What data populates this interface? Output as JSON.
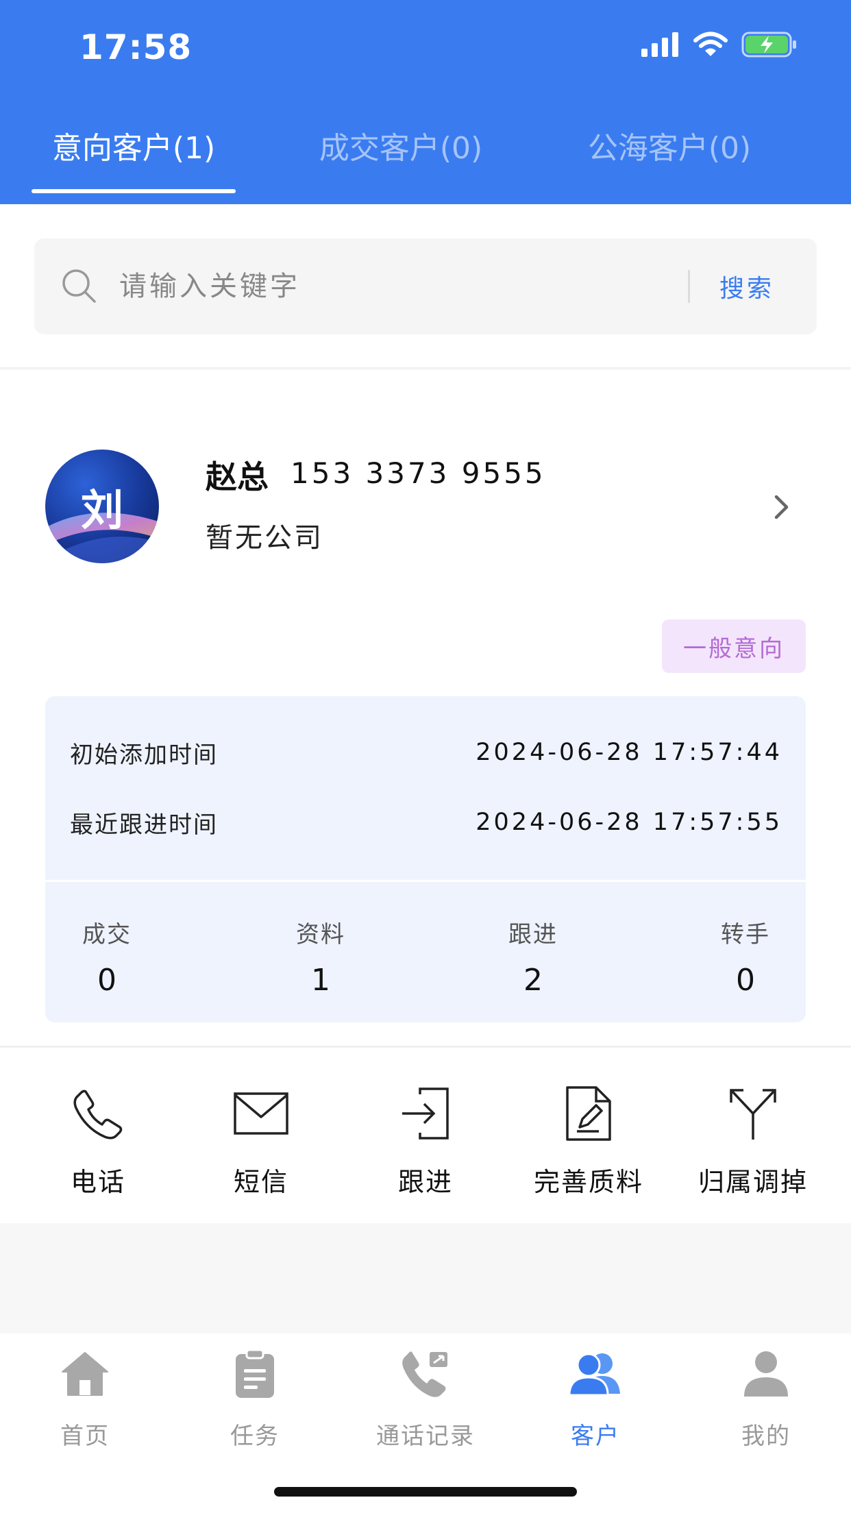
{
  "status_bar": {
    "time": "17:58"
  },
  "tabs": [
    {
      "label": "意向客户(1)",
      "active": true
    },
    {
      "label": "成交客户(0)",
      "active": false
    },
    {
      "label": "公海客户(0)",
      "active": false
    }
  ],
  "search": {
    "placeholder": "请输入关键字",
    "button_label": "搜索"
  },
  "customer": {
    "avatar_char": "刘",
    "name": "赵总",
    "phone": "153 3373 9555",
    "company": "暂无公司",
    "intent_badge": "一般意向",
    "added_label": "初始添加时间",
    "added_time": "2024-06-28 17:57:44",
    "followup_label": "最近跟进时间",
    "followup_time": "2024-06-28 17:57:55",
    "stats": [
      {
        "label": "成交",
        "value": "0"
      },
      {
        "label": "资料",
        "value": "1"
      },
      {
        "label": "跟进",
        "value": "2"
      },
      {
        "label": "转手",
        "value": "0"
      }
    ]
  },
  "actions": [
    {
      "label": "电话",
      "icon": "phone-icon"
    },
    {
      "label": "短信",
      "icon": "envelope-icon"
    },
    {
      "label": "跟进",
      "icon": "login-arrow-icon"
    },
    {
      "label": "完善质料",
      "icon": "edit-document-icon"
    },
    {
      "label": "归属调掉",
      "icon": "split-arrow-icon"
    }
  ],
  "tabbar": [
    {
      "label": "首页",
      "icon": "home-icon",
      "active": false
    },
    {
      "label": "任务",
      "icon": "clipboard-icon",
      "active": false
    },
    {
      "label": "通话记录",
      "icon": "call-log-icon",
      "active": false
    },
    {
      "label": "客户",
      "icon": "customers-icon",
      "active": true
    },
    {
      "label": "我的",
      "icon": "user-icon",
      "active": false
    }
  ],
  "colors": {
    "primary": "#3a7cf0",
    "badge_bg": "#f3e5fb",
    "badge_text": "#b46ad6",
    "panel_bg": "#eef3fe",
    "inactive": "#999999"
  }
}
